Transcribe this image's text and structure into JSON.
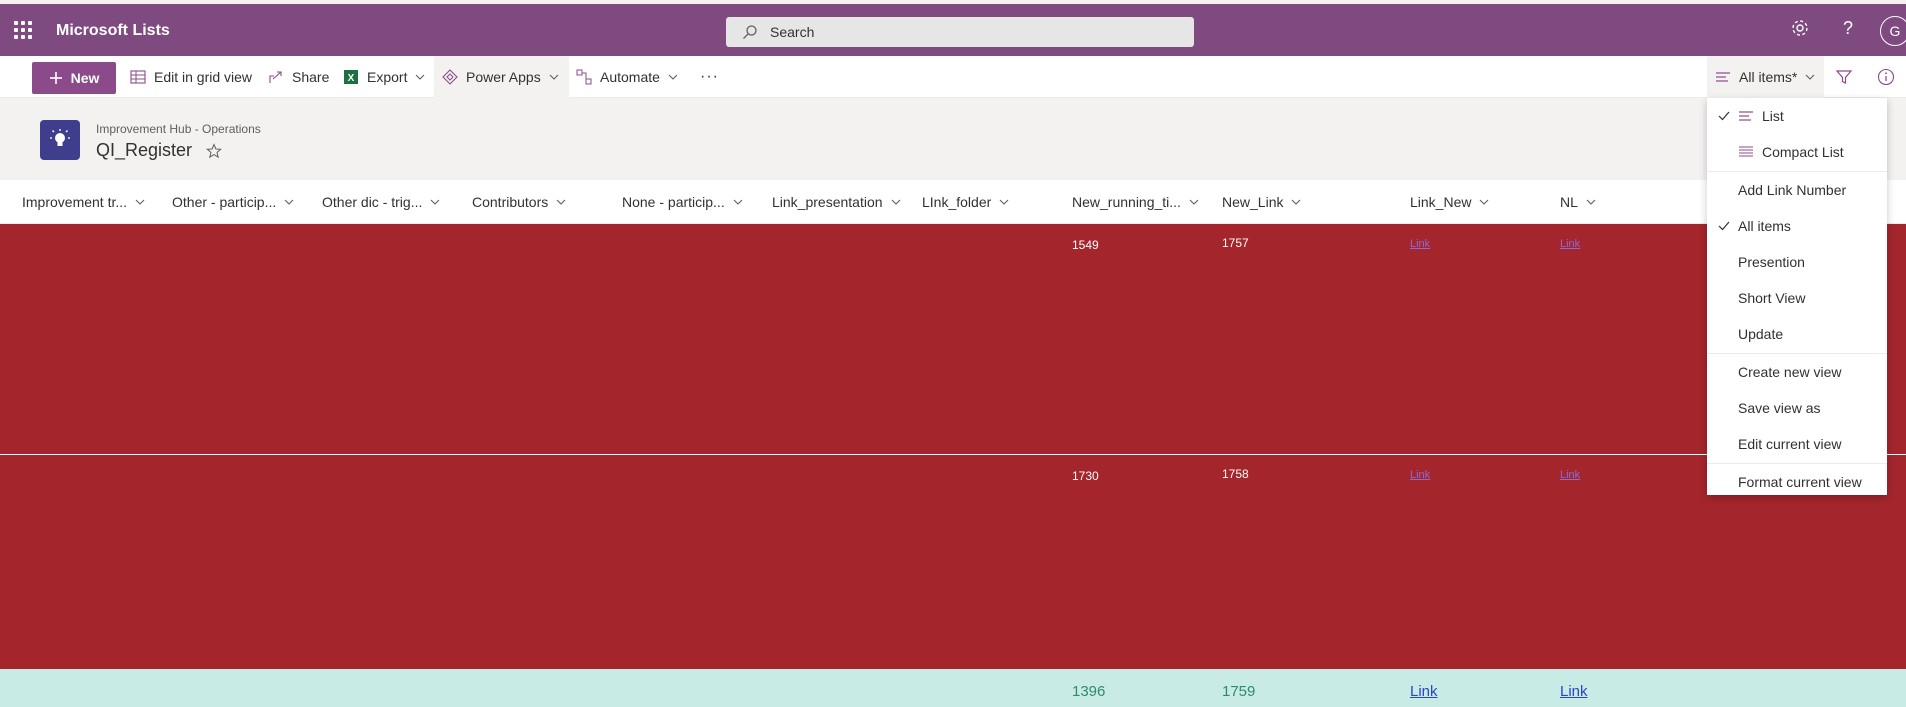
{
  "app": {
    "name": "Microsoft Lists"
  },
  "search": {
    "placeholder": "Search"
  },
  "user": {
    "initial": "G"
  },
  "toolbar": {
    "new_label": "New",
    "edit_grid_label": "Edit in grid view",
    "share_label": "Share",
    "export_label": "Export",
    "power_apps_label": "Power Apps",
    "automate_label": "Automate",
    "more_label": "···",
    "view_label": "All items*"
  },
  "site": {
    "breadcrumb": "Improvement Hub - Operations",
    "title": "QI_Register"
  },
  "columns": [
    {
      "label": "Improvement tr..."
    },
    {
      "label": "Other - particip..."
    },
    {
      "label": "Other dic - trig..."
    },
    {
      "label": "Contributors"
    },
    {
      "label": "None - particip..."
    },
    {
      "label": "Link_presentation"
    },
    {
      "label": "LInk_folder"
    },
    {
      "label": "New_running_ti..."
    },
    {
      "label": "New_Link"
    },
    {
      "label": "Link_New"
    },
    {
      "label": "NL"
    }
  ],
  "rows": [
    {
      "running": "1549",
      "new_link": "1757",
      "link_new": "Link",
      "nl": "Link"
    },
    {
      "running": "1730",
      "new_link": "1758",
      "link_new": "Link",
      "nl": "Link"
    },
    {
      "running": "1396",
      "new_link": "1759",
      "link_new": "Link",
      "nl": "Link"
    }
  ],
  "view_menu": {
    "items": [
      {
        "label": "List",
        "checked": true,
        "icon": "list-icon"
      },
      {
        "label": "Compact List",
        "checked": false,
        "icon": "compact-list-icon"
      },
      {
        "label": "Add Link Number",
        "checked": false
      },
      {
        "label": "All items",
        "checked": true
      },
      {
        "label": "Presention",
        "checked": false
      },
      {
        "label": "Short View",
        "checked": false
      },
      {
        "label": "Update",
        "checked": false
      },
      {
        "label": "Create new view",
        "checked": false
      },
      {
        "label": "Save view as",
        "checked": false
      },
      {
        "label": "Edit current view",
        "checked": false
      },
      {
        "label": "Format current view",
        "checked": false
      }
    ]
  },
  "colors": {
    "suite_bar": "#7f4a7f",
    "new_button": "#8b4b8b",
    "row_red": "#a4262c",
    "row_teal": "#c8ebe6",
    "site_icon": "#3e3e8c"
  }
}
